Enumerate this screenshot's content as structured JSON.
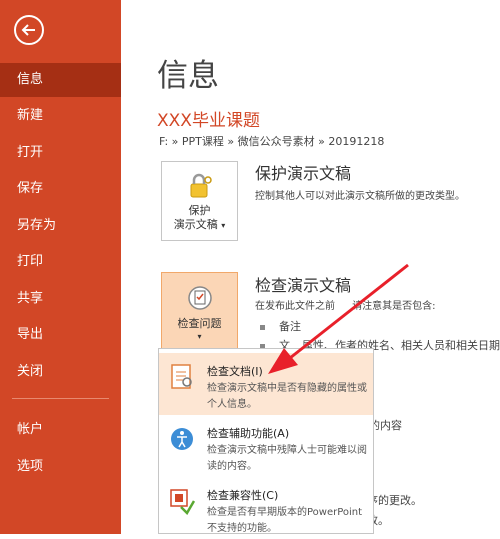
{
  "sidebar": {
    "items": [
      {
        "label": "信息"
      },
      {
        "label": "新建"
      },
      {
        "label": "打开"
      },
      {
        "label": "保存"
      },
      {
        "label": "另存为"
      },
      {
        "label": "打印"
      },
      {
        "label": "共享"
      },
      {
        "label": "导出"
      },
      {
        "label": "关闭"
      },
      {
        "label": "帐户"
      },
      {
        "label": "选项"
      }
    ],
    "accent": "#d24726",
    "active_bg": "#a52f14"
  },
  "main": {
    "title": "信息",
    "doc_title": "XXX毕业课题",
    "breadcrumb": "F: » PPT课程 » 微信公众号素材 » 20191218",
    "protect": {
      "tile_line1": "保护",
      "tile_line2": "演示文稿",
      "title": "保护演示文稿",
      "desc": "控制其他人可以对此演示文稿所做的更改类型。"
    },
    "inspect": {
      "tile_label": "检查问题",
      "title": "检查演示文稿",
      "desc_a": "在发布此文件之前",
      "desc_b": "请注意其是否包含:",
      "bullet1": "备注",
      "bullet2_a": "文",
      "bullet2_b": "属性、作者的姓名、相关人员和相关日期"
    },
    "right_fragments": {
      "f1": "的内容",
      "f2": "序的更改。",
      "f3": "改。"
    }
  },
  "menu": {
    "items": [
      {
        "title": "检查文档(I)",
        "desc": "检查演示文稿中是否有隐藏的属性或个人信息。",
        "icon": "document-inspect-icon"
      },
      {
        "title": "检查辅助功能(A)",
        "desc": "检查演示文稿中残障人士可能难以阅读的内容。",
        "icon": "accessibility-icon"
      },
      {
        "title": "检查兼容性(C)",
        "desc": "检查是否有早期版本的PowerPoint 不支持的功能。",
        "icon": "compatibility-icon"
      }
    ]
  },
  "annotation": {
    "arrow_color": "#e8202a"
  }
}
